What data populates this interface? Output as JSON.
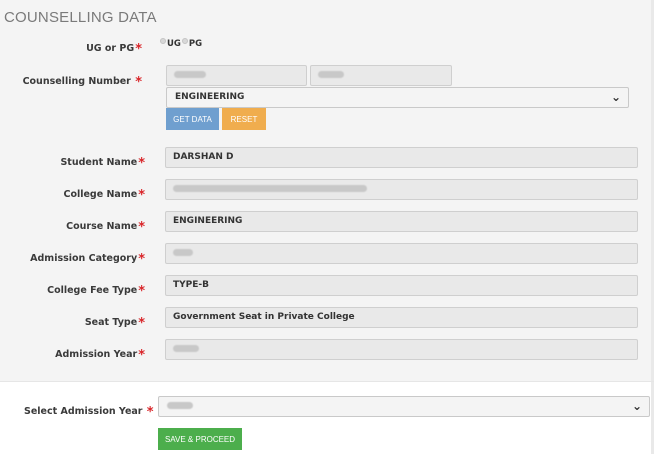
{
  "title": "COUNSELLING DATA",
  "required_mark": "*",
  "ug_pg": {
    "label": "UG or PG",
    "option_ug": "UG",
    "option_pg": "PG"
  },
  "counselling_number": {
    "label": "Counselling Number",
    "stream_select": "ENGINEERING"
  },
  "buttons": {
    "get_data": "GET DATA",
    "reset": "RESET",
    "save_proceed": "SAVE & PROCEED"
  },
  "fields": {
    "student_name": {
      "label": "Student Name",
      "value": "DARSHAN D"
    },
    "college_name": {
      "label": "College Name"
    },
    "course_name": {
      "label": "Course Name",
      "value": "ENGINEERING"
    },
    "admission_category": {
      "label": "Admission Category"
    },
    "college_fee_type": {
      "label": "College Fee Type",
      "value": "TYPE-B"
    },
    "seat_type": {
      "label": "Seat Type",
      "value": "Government Seat in Private College"
    },
    "admission_year": {
      "label": "Admission Year"
    }
  },
  "select_admission_year": {
    "label": "Select Admission Year"
  },
  "colors": {
    "get_data_bg": "#6f9fcf",
    "reset_bg": "#f0ad4e",
    "save_bg": "#4cae4c",
    "required": "#d9262a"
  },
  "icons": {
    "dropdown": "chevron-down-icon",
    "radio": "radio-icon"
  }
}
